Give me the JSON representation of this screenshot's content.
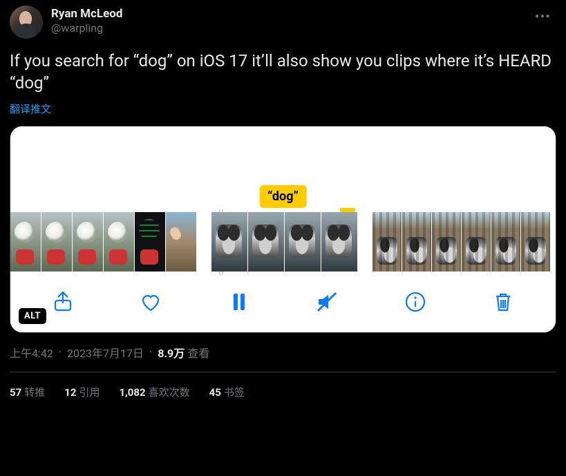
{
  "header": {
    "display_name": "Ryan McLeod",
    "handle": "@warpling"
  },
  "body_text": "If you search for “dog” on iOS 17 it’ll also show you clips where it’s HEARD “dog”",
  "translate_label": "翻译推文",
  "media": {
    "tag_label": "“dog”",
    "alt_badge": "ALT"
  },
  "meta": {
    "time": "上午4:42",
    "date": "2023年7月17日",
    "views_number": "8.9万",
    "views_label": "查看"
  },
  "counts": {
    "retweets_num": "57",
    "retweets_label": "转推",
    "quotes_num": "12",
    "quotes_label": "引用",
    "likes_num": "1,082",
    "likes_label": "喜欢次数",
    "bookmarks_num": "45",
    "bookmarks_label": "书签"
  }
}
